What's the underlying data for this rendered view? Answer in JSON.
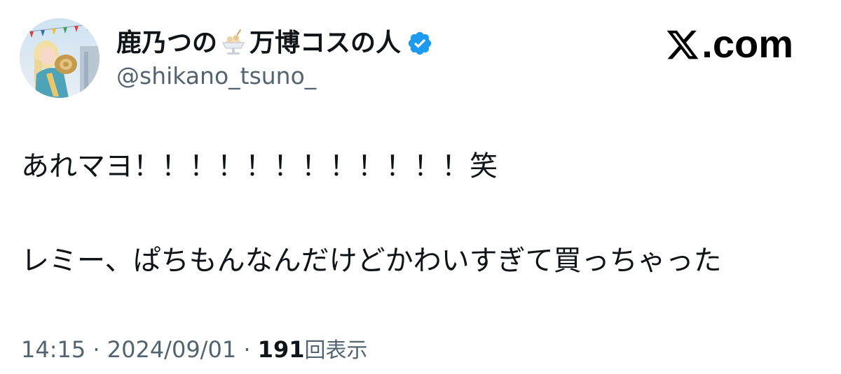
{
  "user": {
    "name_part1": "鹿乃つの",
    "name_part2": "万博コスの人",
    "name_emoji": "shaved-ice-icon",
    "verified_icon": "verified-badge-icon",
    "handle": "@shikano_tsuno_"
  },
  "brand": {
    "logo_icon": "x-logo-icon",
    "suffix": ".com"
  },
  "tweet": {
    "line1": "あれマヨ！！！！！！！！！！！！笑",
    "line2": "レミー、ぱちもんなんだけどかわいすぎて買っちゃった"
  },
  "meta": {
    "time": "14:15",
    "separator": "·",
    "date": "2024/09/01",
    "views_count": "191",
    "views_label": "回表示"
  },
  "colors": {
    "text": "#0f1419",
    "secondary": "#536471",
    "verified": "#1d9bf0"
  }
}
